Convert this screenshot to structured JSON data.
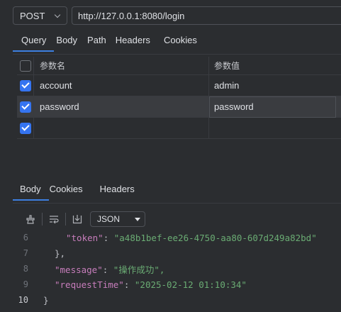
{
  "request": {
    "method": "POST",
    "url": "http://127.0.0.1:8080/login"
  },
  "request_tabs": [
    {
      "label": "Query",
      "active": true
    },
    {
      "label": "Body",
      "active": false
    },
    {
      "label": "Path",
      "active": false
    },
    {
      "label": "Headers",
      "active": false
    },
    {
      "label": "Cookies",
      "active": false
    }
  ],
  "params_table": {
    "headers": {
      "name": "参数名",
      "value": "参数值"
    },
    "rows": [
      {
        "checked": true,
        "name": "account",
        "value": "admin"
      },
      {
        "checked": true,
        "name": "password",
        "value": "password"
      },
      {
        "checked": true,
        "name": "",
        "value": ""
      }
    ]
  },
  "response_tabs": [
    {
      "label": "Body",
      "active": true
    },
    {
      "label": "Cookies",
      "active": false
    },
    {
      "label": "Headers",
      "active": false
    }
  ],
  "response_toolbar": {
    "format": "JSON"
  },
  "code_lines": [
    {
      "n": "6",
      "key": "\"token\"",
      "value": "\"a48b1bef-ee26-4750-aa80-607d249a82bd\""
    },
    {
      "n": "7",
      "text": "},"
    },
    {
      "n": "8",
      "key": "\"message\"",
      "value": "\"操作成功\","
    },
    {
      "n": "9",
      "key": "\"requestTime\"",
      "value": "\"2025-02-12 01:10:34\""
    },
    {
      "n": "10",
      "text": "}"
    }
  ],
  "colors": {
    "accent": "#3574f0",
    "tab_underline": "#3d7fe0",
    "json_key": "#c77dbb",
    "json_string": "#6aab73"
  }
}
